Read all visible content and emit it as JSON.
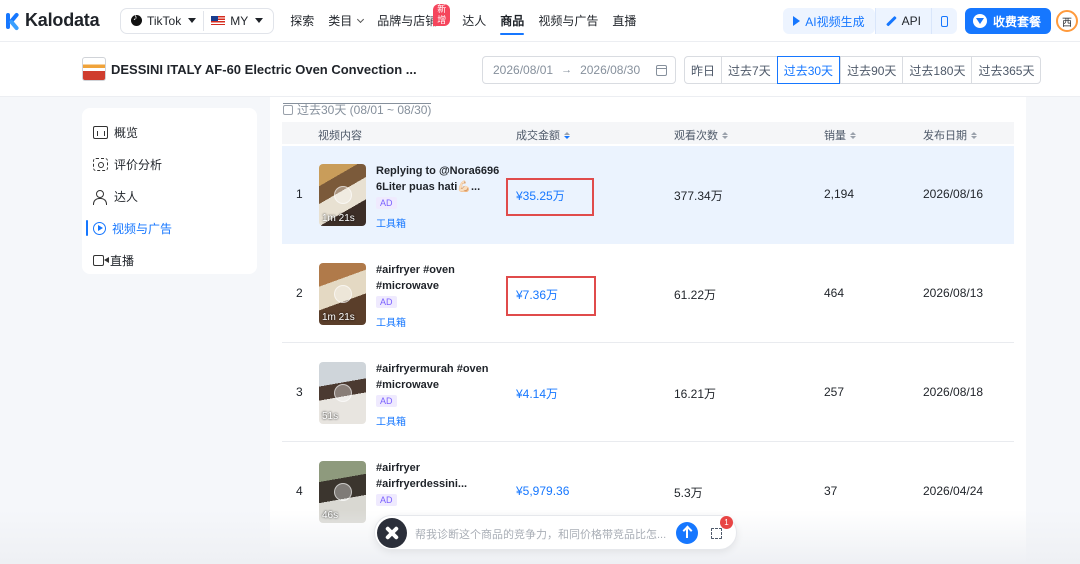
{
  "brand": {
    "logo_text": "Kalodata"
  },
  "selector": {
    "platform": "TikTok",
    "region": "MY"
  },
  "nav": {
    "items": [
      "探索",
      "类目",
      "品牌与店铺",
      "达人",
      "商品",
      "视频与广告",
      "直播"
    ],
    "new_badge": "新增",
    "active": "商品"
  },
  "toolbar": {
    "ai_video": "AI视频生成",
    "api": "API",
    "vip": "收费套餐",
    "avatar_initial": "西"
  },
  "product": {
    "title": "DESSINI ITALY AF-60 Electric Oven Convection ..."
  },
  "date_range": {
    "start": "2026/08/01",
    "end": "2026/08/30",
    "arrow": "→"
  },
  "periods": [
    "昨日",
    "过去7天",
    "过去30天",
    "过去90天",
    "过去180天",
    "过去365天"
  ],
  "active_period": "过去30天",
  "sidebar": {
    "items": [
      "概览",
      "评价分析",
      "达人",
      "视频与广告",
      "直播"
    ],
    "active": "视频与广告"
  },
  "caption": "过去30天 (08/01 ~ 08/30)",
  "table": {
    "headers": [
      "视频内容",
      "成交金额",
      "观看次数",
      "销量",
      "发布日期"
    ],
    "rows": [
      {
        "rank": "1",
        "title": "Replying to @Nora6696 6Liter puas hati💪🏻...",
        "ad": "AD",
        "tool": "工具箱",
        "duration": "1m 21s",
        "amount": "¥35.25万",
        "views": "377.34万",
        "sales": "2,194",
        "date": "2026/08/16"
      },
      {
        "rank": "2",
        "title": "#airfryer #oven #microwave",
        "ad": "AD",
        "tool": "工具箱",
        "duration": "1m 21s",
        "amount": "¥7.36万",
        "views": "61.22万",
        "sales": "464",
        "date": "2026/08/13"
      },
      {
        "rank": "3",
        "title": "#airfryermurah #oven #microwave",
        "ad": "AD",
        "tool": "工具箱",
        "duration": "51s",
        "amount": "¥4.14万",
        "views": "16.21万",
        "sales": "257",
        "date": "2026/08/18"
      },
      {
        "rank": "4",
        "title": "#airfryer #airfryerdessini...",
        "ad": "AD",
        "tool": "",
        "duration": "46s",
        "amount": "¥5,979.36",
        "views": "5.3万",
        "sales": "37",
        "date": "2026/04/24"
      }
    ]
  },
  "assistant": {
    "placeholder": "帮我诊断这个商品的竞争力，和同价格带竞品比怎...",
    "notification_count": "1"
  },
  "colors": {
    "accent": "#1677ff",
    "highlight_row": "#ebf3fe",
    "annotation_red": "#e04b4b"
  }
}
